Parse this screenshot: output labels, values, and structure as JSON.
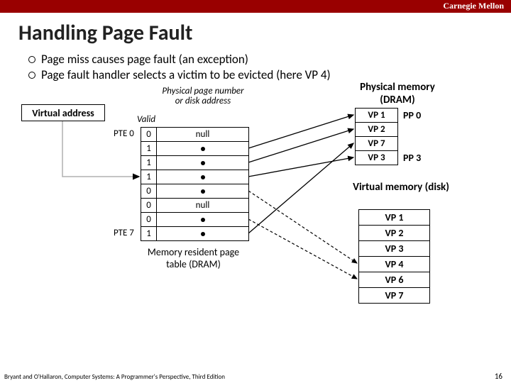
{
  "brand": "Carnegie Mellon",
  "title": "Handling Page Fault",
  "bullets": [
    "Page miss causes page fault (an exception)",
    "Page fault handler selects a victim to be evicted (here VP 4)"
  ],
  "va_label": "Virtual address",
  "col_valid": "Valid",
  "col_ppn": "Physical page number or disk address",
  "pte_first": "PTE 0",
  "pte_last": "PTE 7",
  "page_table": {
    "rows": [
      {
        "valid": "0",
        "ppn_text": "null",
        "dot": false
      },
      {
        "valid": "1",
        "ppn_text": "",
        "dot": true
      },
      {
        "valid": "1",
        "ppn_text": "",
        "dot": true
      },
      {
        "valid": "1",
        "ppn_text": "",
        "dot": true
      },
      {
        "valid": "0",
        "ppn_text": "",
        "dot": true
      },
      {
        "valid": "0",
        "ppn_text": "null",
        "dot": false
      },
      {
        "valid": "0",
        "ppn_text": "",
        "dot": true
      },
      {
        "valid": "1",
        "ppn_text": "",
        "dot": true
      }
    ],
    "caption": "Memory resident page table (DRAM)"
  },
  "phys_mem": {
    "title": "Physical memory (DRAM)",
    "cells": [
      "VP 1",
      "VP 2",
      "VP 7",
      "VP 3"
    ],
    "right_labels": {
      "0": "PP 0",
      "3": "PP 3"
    }
  },
  "virt_mem": {
    "title": "Virtual memory (disk)",
    "cells": [
      "VP 1",
      "VP 2",
      "VP 3",
      "VP 4",
      "VP 6",
      "VP 7"
    ]
  },
  "footer": "Bryant and O'Hallaron, Computer Systems: A Programmer's Perspective, Third Edition",
  "pagenum": "16"
}
